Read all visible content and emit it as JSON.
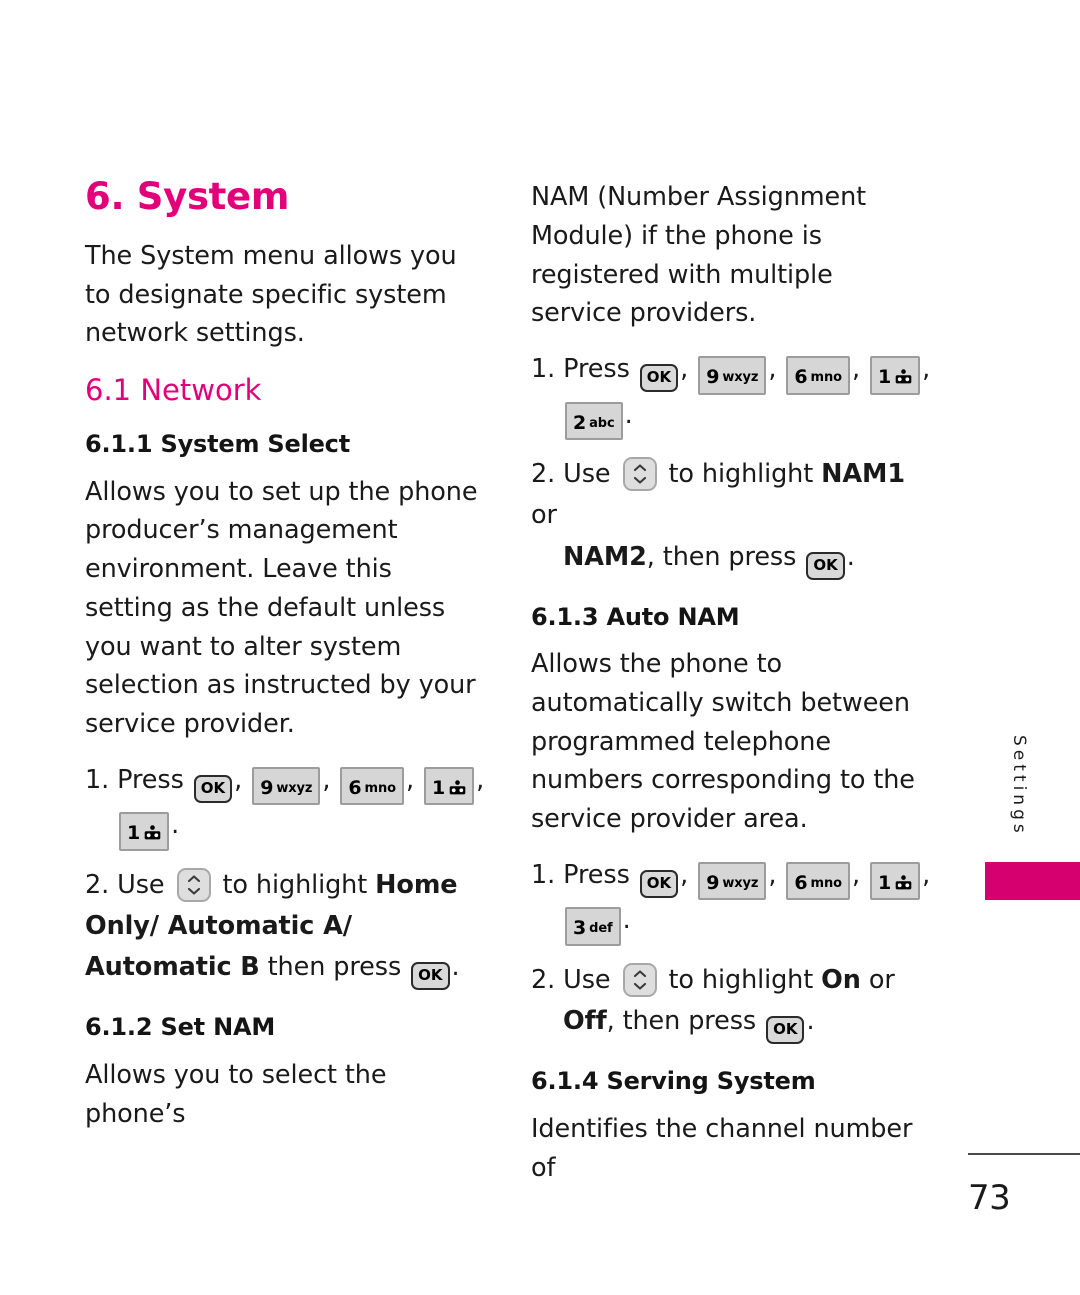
{
  "page": {
    "number": "73",
    "side_tab": "Settings",
    "accent_color": "#e2007a",
    "bar_color": "#d6006e"
  },
  "left_column": {
    "chapter_heading": "6. System",
    "intro": "The System menu allows you to designate specific system network settings.",
    "section_heading": "6.1 Network",
    "subsections": [
      {
        "heading": "6.1.1 System Select",
        "body": "Allows you to set up the phone producer’s management environment. Leave this setting as the default unless you want to alter system selection as instructed by your service provider.",
        "steps": [
          {
            "number": "1.",
            "verb": "Press",
            "keys": [
              "OK",
              "9 wxyz",
              "6 mno",
              "1 @",
              "1 @"
            ],
            "trailing": "."
          },
          {
            "number": "2.",
            "lead": "Use",
            "nav_key": "up-down",
            "mid": "to highlight",
            "bold_options": "Home Only/ Automatic A/ Automatic B",
            "tail": "then press",
            "end_key": "OK",
            "trailing": "."
          }
        ]
      },
      {
        "heading": "6.1.2 Set NAM",
        "body": "Allows you to select the phone’s"
      }
    ]
  },
  "right_column": {
    "continued_paragraph": "NAM (Number Assignment Module) if the phone is registered with multiple service providers.",
    "subsections": [
      {
        "steps": [
          {
            "number": "1.",
            "verb": "Press",
            "keys": [
              "OK",
              "9 wxyz",
              "6 mno",
              "1 @",
              "2 abc"
            ],
            "trailing": "."
          },
          {
            "number": "2.",
            "lead": "Use",
            "nav_key": "up-down",
            "mid": "to highlight",
            "bold_option_1": "NAM1",
            "conjunction": "or",
            "bold_option_2": "NAM2",
            "tail": ", then press",
            "end_key": "OK",
            "trailing": "."
          }
        ]
      },
      {
        "heading": "6.1.3 Auto NAM",
        "body": "Allows the phone to automatically switch between programmed telephone numbers corresponding to the service provider area.",
        "steps": [
          {
            "number": "1.",
            "verb": "Press",
            "keys": [
              "OK",
              "9 wxyz",
              "6 mno",
              "1 @",
              "3 def"
            ],
            "trailing": "."
          },
          {
            "number": "2.",
            "lead": "Use",
            "nav_key": "up-down",
            "mid": "to highlight",
            "bold_option_1": "On",
            "conjunction": "or",
            "bold_option_2": "Off",
            "tail": ", then press",
            "end_key": "OK",
            "trailing": "."
          }
        ]
      },
      {
        "heading": "6.1.4 Serving System",
        "body": "Identifies the channel number of"
      }
    ]
  },
  "keys": {
    "ok_label": "OK",
    "k9_digit": "9",
    "k9_letters": "wxyz",
    "k6_digit": "6",
    "k6_letters": "mno",
    "k1_digit": "1",
    "k1_letters": "@",
    "k2_digit": "2",
    "k2_letters": "abc",
    "k3_digit": "3",
    "k3_letters": "def"
  }
}
